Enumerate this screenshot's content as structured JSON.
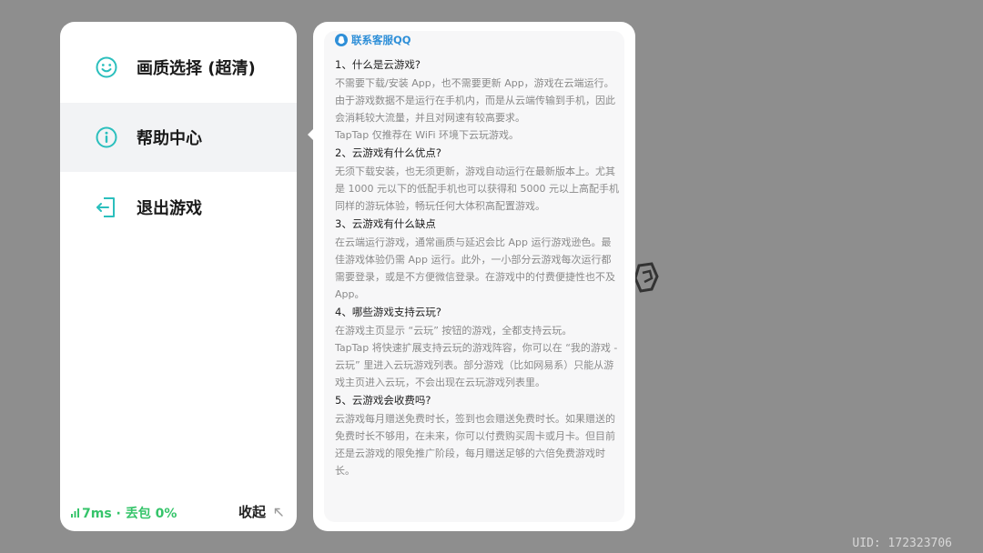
{
  "menu": {
    "items": [
      {
        "label": "画质选择 (超清)",
        "icon": "smile-icon",
        "active": false
      },
      {
        "label": "帮助中心",
        "icon": "info-icon",
        "active": true
      },
      {
        "label": "退出游戏",
        "icon": "exit-icon",
        "active": false
      }
    ]
  },
  "footer": {
    "network_status": "7ms · 丢包 0%",
    "collapse_label": "收起"
  },
  "help": {
    "qq_link": "联系客服QQ",
    "faq": [
      {
        "q": "1、什么是云游戏?",
        "a": "不需要下载/安装 App，也不需要更新 App，游戏在云端运行。由于游戏数据不是运行在手机内，而是从云端传输到手机，因此会消耗较大流量，并且对网速有较高要求。\nTapTap 仅推荐在 WiFi 环境下云玩游戏。"
      },
      {
        "q": "2、云游戏有什么优点?",
        "a": "无须下载安装，也无须更新，游戏自动运行在最新版本上。尤其是 1000 元以下的低配手机也可以获得和 5000 元以上高配手机同样的游玩体验，畅玩任何大体积高配置游戏。"
      },
      {
        "q": "3、云游戏有什么缺点",
        "a": "在云端运行游戏，通常画质与延迟会比 App 运行游戏逊色。最佳游戏体验仍需 App 运行。此外，一小部分云游戏每次运行都需要登录，或是不方便微信登录。在游戏中的付费便捷性也不及 App。"
      },
      {
        "q": "4、哪些游戏支持云玩?",
        "a": "在游戏主页显示 “云玩” 按钮的游戏，全都支持云玩。\nTapTap 将快速扩展支持云玩的游戏阵容，你可以在 “我的游戏 - 云玩” 里进入云玩游戏列表。部分游戏（比如网易系）只能从游戏主页进入云玩，不会出现在云玩游戏列表里。"
      },
      {
        "q": "5、云游戏会收费吗?",
        "a": "云游戏每月赠送免费时长，签到也会赠送免费时长。如果赠送的免费时长不够用，在未来，你可以付费购买周卡或月卡。但目前还是云游戏的限免推广阶段，每月赠送足够的六倍免费游戏时长。"
      }
    ]
  },
  "uid": "UID: 172323706",
  "colors": {
    "accent_teal": "#2bbfbd",
    "status_green": "#35c46a",
    "link_blue": "#2e8fd8",
    "overlay_gray": "#8e8e8e"
  }
}
